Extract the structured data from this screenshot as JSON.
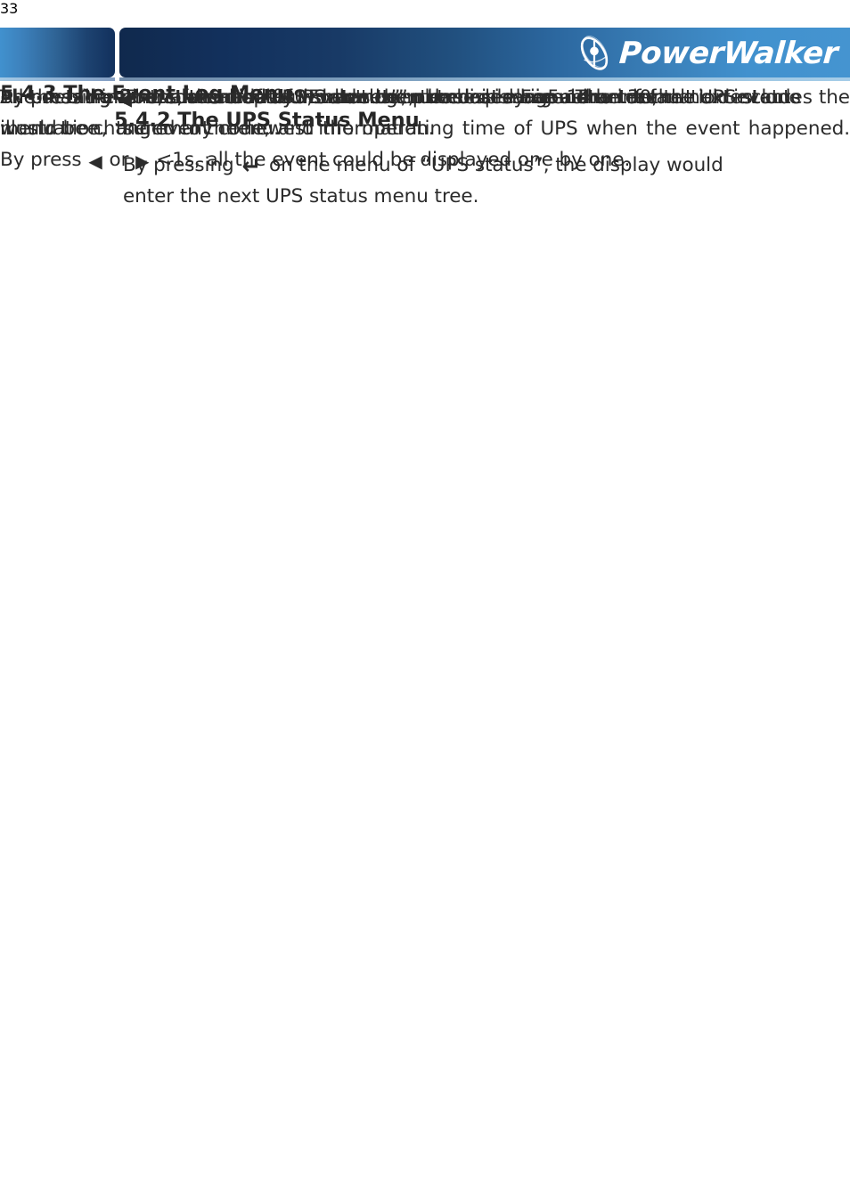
{
  "header": {
    "logo_text": "PowerWalker",
    "logo_mark_name": "powerwalker-globe-logo"
  },
  "document": {
    "page_number": "33",
    "sections": [
      {
        "id": "5.4.2",
        "heading": "5.4.2 The UPS Status Menu",
        "paragraphs": [
          {
            "parts": [
              {
                "type": "text",
                "value": "By pressing "
              },
              {
                "type": "glyph",
                "icon": "enter-key-icon",
                "value": "↵"
              },
              {
                "type": "text",
                "value": " on the menu of “UPS status”, the display would enter the next UPS status menu tree."
              }
            ],
            "text_prefix": "By pressing ",
            "text_suffix": " on the menu of “UPS status”, the display would enter the next UPS status menu tree.",
            "glyph": "↵",
            "justify": false
          },
          {
            "text": "The content of UPS status menu tree is same as the default UPS status summary menu.",
            "justify": false
          },
          {
            "text_prefix": "By pressing ",
            "glyph": "◀",
            "text_suffix": " >1s, the display would return the last main menu tree.",
            "justify": true
          },
          {
            "text": "The detail information about “UPS status”, please see Fig5-14",
            "justify": false
          }
        ]
      },
      {
        "id": "5.4.3",
        "heading": "5.4.3 The Event Log Menu",
        "paragraphs": [
          {
            "text_prefix": "By pressing ",
            "glyph": "↵",
            "text_suffix": " on the menu of “Event log”, the display would enter the next event menu tree.",
            "justify": false
          },
          {
            "text_prefix": "All the old event, alarm and fault have been recorded here. The information includes the illustration, the event code, and the operating time of UPS when the event happened. By press ",
            "glyph": "◀",
            "text_middle": " or ",
            "glyph2": "▶",
            "text_suffix": " <1s, all the event could be displayed one by one.",
            "justify": true
          },
          {
            "text": "The max number of record is 30, when the number is larger than 30, the oldest one would be changed to the newest information.",
            "justify": false
          },
          {
            "text_prefix": "By pressing ",
            "glyph": "◀",
            "text_suffix": " >1s, the display would return the last main menu tree.",
            "justify": true
          }
        ]
      }
    ]
  },
  "colors": {
    "header_light_blue": "#4191ce",
    "header_dark_navy": "#12305c",
    "text": "#2b2b2b",
    "heading": "#262626"
  }
}
